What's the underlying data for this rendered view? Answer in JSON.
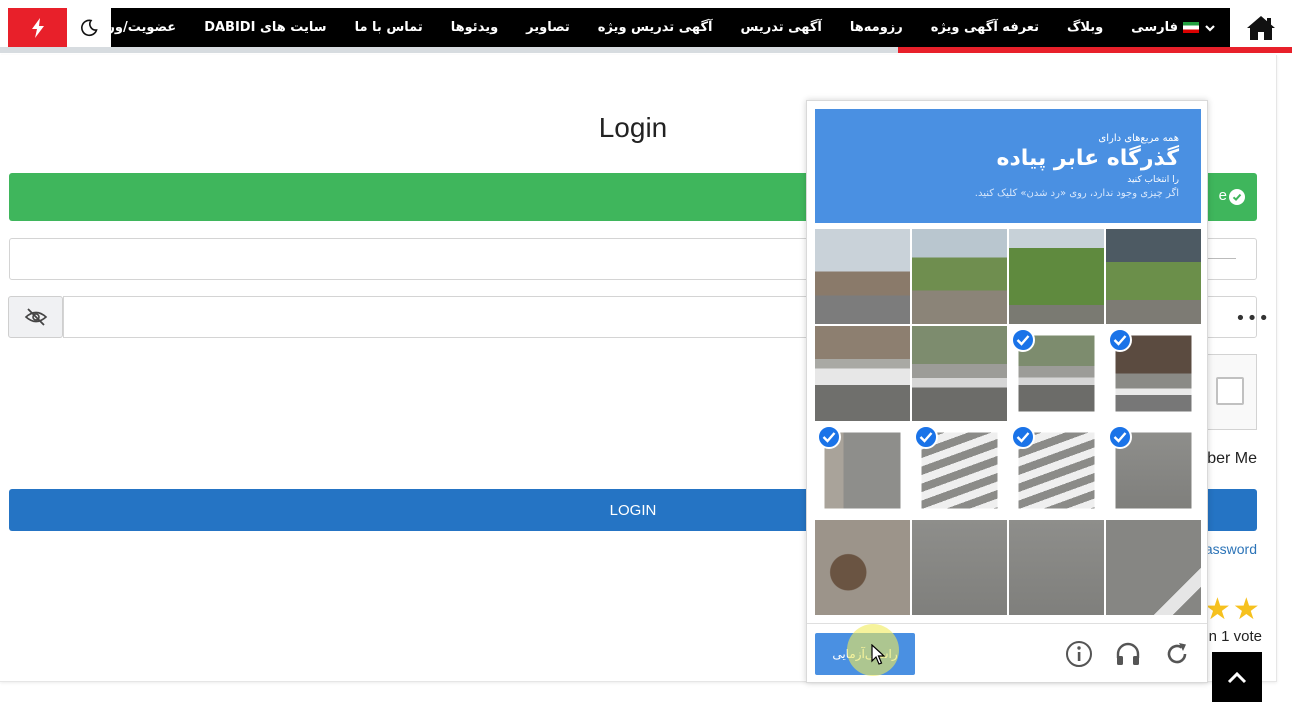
{
  "nav": {
    "items": [
      {
        "label": "فارسی",
        "icon": "flag-iran-icon",
        "dropdown": true
      },
      {
        "label": "وبلاگ"
      },
      {
        "label": "تعرفه آگهی ویژه"
      },
      {
        "label": "رزومه‌ها"
      },
      {
        "label": "آگهی تدریس"
      },
      {
        "label": "آگهی تدریس ویژه"
      },
      {
        "label": "تصاویر"
      },
      {
        "label": "ویدئوها"
      },
      {
        "label": "تماس با ما"
      },
      {
        "label": "سایت های DABIDI"
      },
      {
        "label": "عضویت/ورود"
      }
    ],
    "home_icon": "home-icon",
    "moon_icon": "moon-icon",
    "bolt_icon": "bolt-icon",
    "accent_color": "#e8202a"
  },
  "login": {
    "title": "Login",
    "success_text": "e",
    "password_mask": "•••",
    "remember_label": "ber Me",
    "login_button": "LOGIN",
    "forgot_link": "assword",
    "votes_text": "n 1 vote",
    "button_color": "#2574c4",
    "success_color": "#3fb65c"
  },
  "recaptcha": {
    "header_sub": "همه مربع‌های دارای",
    "header_title": "گذرگاه عابر پیاده",
    "header_small": "را انتخاب کنید",
    "header_hint": "اگر چیزی وجود ندارد، روی «رد شدن» کلیک کنید.",
    "verify_label": "راستی‌آزمایی",
    "tiles": [
      {
        "row": 0,
        "col": 0,
        "selected": false,
        "scene": "church-sky"
      },
      {
        "row": 0,
        "col": 1,
        "selected": false,
        "scene": "trees-building"
      },
      {
        "row": 0,
        "col": 2,
        "selected": false,
        "scene": "trees"
      },
      {
        "row": 0,
        "col": 3,
        "selected": false,
        "scene": "billboard-trees"
      },
      {
        "row": 1,
        "col": 0,
        "selected": false,
        "scene": "white-car"
      },
      {
        "row": 1,
        "col": 1,
        "selected": false,
        "scene": "street-car"
      },
      {
        "row": 1,
        "col": 2,
        "selected": true,
        "scene": "street-car"
      },
      {
        "row": 1,
        "col": 3,
        "selected": true,
        "scene": "shop-crosswalk"
      },
      {
        "row": 2,
        "col": 0,
        "selected": true,
        "scene": "pedestrian-road"
      },
      {
        "row": 2,
        "col": 1,
        "selected": true,
        "scene": "crosswalk"
      },
      {
        "row": 2,
        "col": 2,
        "selected": true,
        "scene": "crosswalk"
      },
      {
        "row": 2,
        "col": 3,
        "selected": true,
        "scene": "road"
      },
      {
        "row": 3,
        "col": 0,
        "selected": false,
        "scene": "sidewalk-manhole"
      },
      {
        "row": 3,
        "col": 1,
        "selected": false,
        "scene": "road"
      },
      {
        "row": 3,
        "col": 2,
        "selected": false,
        "scene": "road"
      },
      {
        "row": 3,
        "col": 3,
        "selected": false,
        "scene": "road-marking"
      }
    ],
    "footer_icons": [
      "reload-icon",
      "headphones-icon",
      "info-icon"
    ],
    "brand_color": "#4a90e2"
  }
}
